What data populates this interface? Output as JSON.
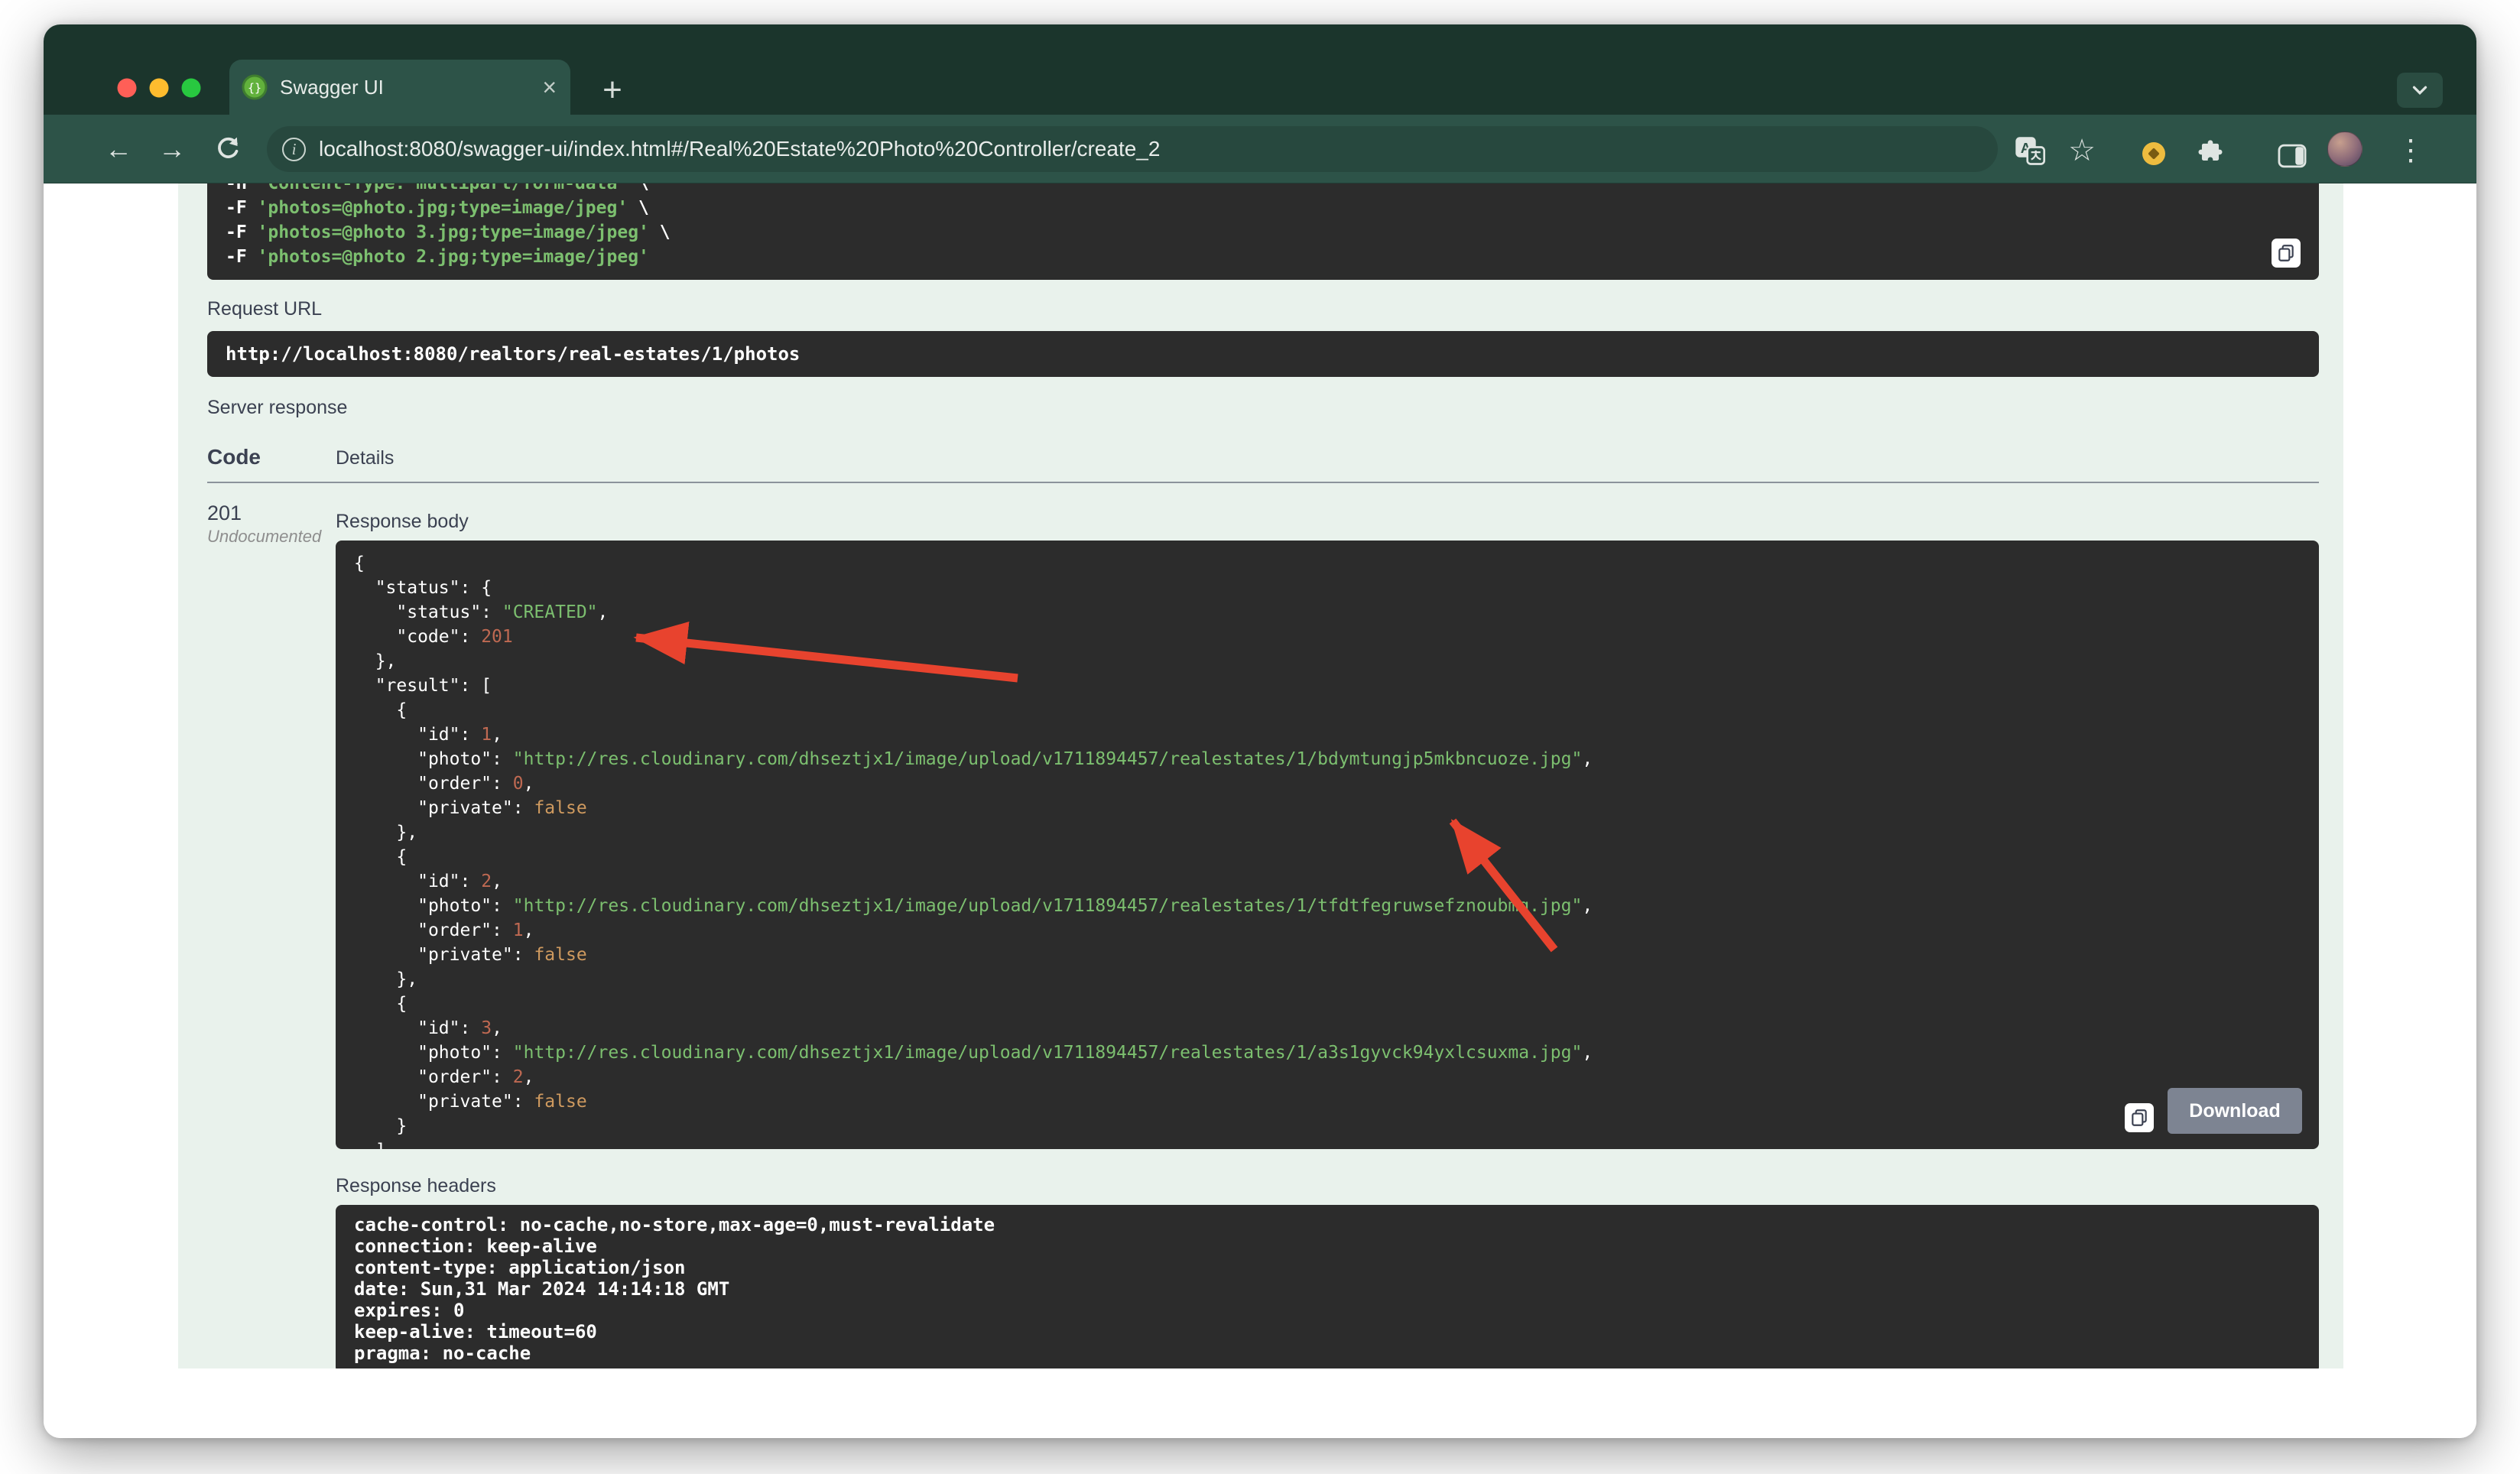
{
  "window_controls": {
    "close": "#ff5f57",
    "minimize": "#febc2e",
    "zoom": "#28c840"
  },
  "browser": {
    "tab_title": "Swagger UI",
    "url": "localhost:8080/swagger-ui/index.html#/Real%20Estate%20Photo%20Controller/create_2",
    "icons": {
      "back": "←",
      "forward": "→",
      "tab_close": "×",
      "new_tab": "+",
      "star": "☆",
      "menu": "⋮",
      "info": "i"
    }
  },
  "curl_block": {
    "lines": [
      "-H 'Content-Type: multipart/form-data' \\",
      "-F 'photos=@photo.jpg;type=image/jpeg' \\",
      "-F 'photos=@photo 3.jpg;type=image/jpeg' \\",
      "-F 'photos=@photo 2.jpg;type=image/jpeg'"
    ]
  },
  "request_url": {
    "label": "Request URL",
    "value": "http://localhost:8080/realtors/real-estates/1/photos"
  },
  "server_response": {
    "label": "Server response",
    "code_header": "Code",
    "details_header": "Details",
    "code": "201",
    "code_note": "Undocumented",
    "response_body_label": "Response body",
    "download_label": "Download",
    "response_headers_label": "Response headers",
    "body_lines": [
      "{",
      "  \"status\": {",
      "    \"status\": \"CREATED\",",
      "    \"code\": 201",
      "  },",
      "  \"result\": [",
      "    {",
      "      \"id\": 1,",
      "      \"photo\": \"http://res.cloudinary.com/dhseztjx1/image/upload/v1711894457/realestates/1/bdymtungjp5mkbncuoze.jpg\",",
      "      \"order\": 0,",
      "      \"private\": false",
      "    },",
      "    {",
      "      \"id\": 2,",
      "      \"photo\": \"http://res.cloudinary.com/dhseztjx1/image/upload/v1711894457/realestates/1/tfdtfegruwsefznoubmq.jpg\",",
      "      \"order\": 1,",
      "      \"private\": false",
      "    },",
      "    {",
      "      \"id\": 3,",
      "      \"photo\": \"http://res.cloudinary.com/dhseztjx1/image/upload/v1711894457/realestates/1/a3s1gyvck94yxlcsuxma.jpg\",",
      "      \"order\": 2,",
      "      \"private\": false",
      "    }",
      "  ]"
    ],
    "header_lines": [
      "cache-control: no-cache,no-store,max-age=0,must-revalidate",
      "connection: keep-alive",
      "content-type: application/json",
      "date: Sun,31 Mar 2024 14:14:18 GMT",
      "expires: 0",
      "keep-alive: timeout=60",
      "pragma: no-cache"
    ]
  },
  "annotations": {
    "arrow_color": "#e8432e"
  }
}
